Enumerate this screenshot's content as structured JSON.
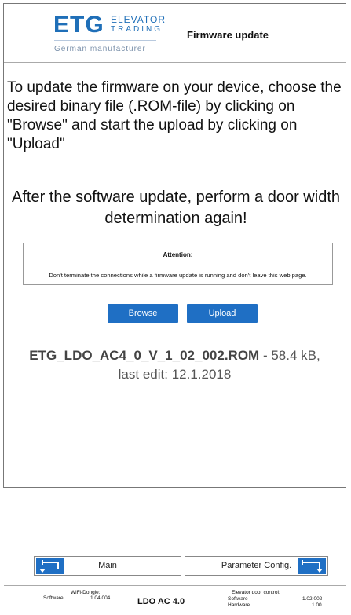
{
  "header": {
    "logo_main": "ETG",
    "logo_line1": "ELEVATOR",
    "logo_line2": "TRADING",
    "logo_sub": "German manufacturer",
    "title": "Firmware update"
  },
  "content": {
    "instructions": "To update the firmware on your device, choose the desired binary file (.ROM-file) by clicking on \"Browse\" and start the upload by clicking on \"Upload\"",
    "note": "After the software update, perform a door width determination again!",
    "attention_title": "Attention:",
    "attention_text": "Don't terminate the connections while a firmware update is running and don't leave this web page.",
    "browse_label": "Browse",
    "upload_label": "Upload",
    "file_name": "ETG_LDO_AC4_0_V_1_02_002.ROM",
    "file_size": " - 58.4 kB,",
    "last_edit": "last edit: 12.1.2018"
  },
  "nav": {
    "main_label": "Main",
    "param_label": "Parameter Config."
  },
  "footer": {
    "wifi_title": "WiFi-Dongle:",
    "wifi_software_label": "Software",
    "wifi_software_value": "1.04.004",
    "device_name": "LDO AC 4.0",
    "door_title": "Elevator door control:",
    "door_software_label": "Software",
    "door_software_value": "1.02.002",
    "door_hardware_label": "Hardware",
    "door_hardware_value": "1.00"
  },
  "colors": {
    "accent": "#1f6fc4",
    "logo_blue": "#1f6fb8"
  }
}
